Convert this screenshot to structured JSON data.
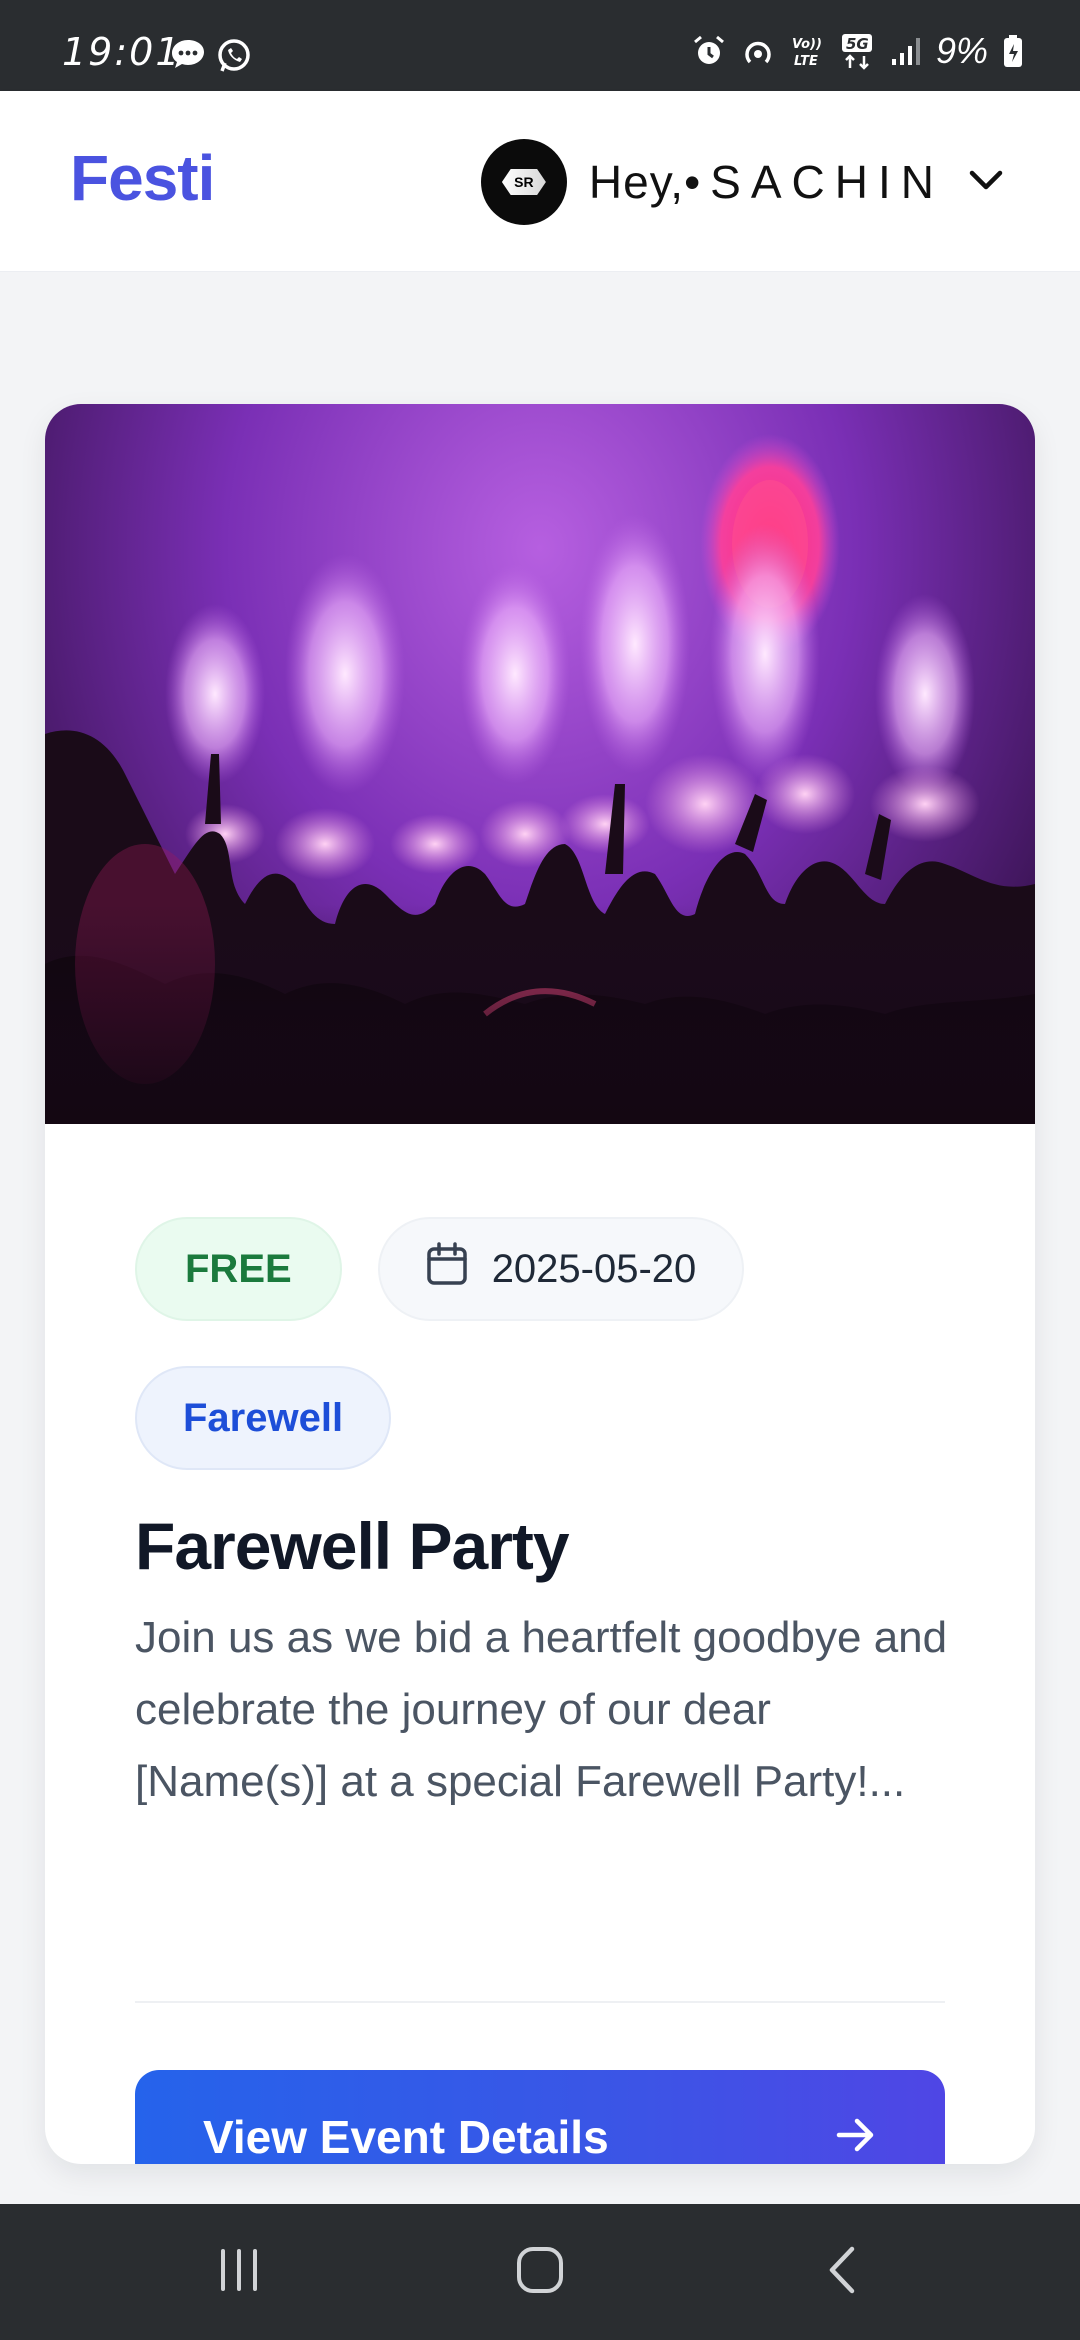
{
  "status_bar": {
    "time": "19:01",
    "battery": "9%",
    "left_icons": [
      "chat-bubble-icon",
      "whatsapp-icon"
    ],
    "right_icons": [
      "alarm-icon",
      "hotspot-icon",
      "volte-icon",
      "5g-icon",
      "signal-icon",
      "battery-icon"
    ],
    "network_label_1": "Vo))\nLTE",
    "network_label_2": "5G"
  },
  "header": {
    "brand": "Festi",
    "greeting": "Hey, ",
    "username": "•SACHIN",
    "avatar_initials": "SR",
    "dropdown_icon": "chevron-down-icon"
  },
  "event": {
    "price_badge": "FREE",
    "date": "2025-05-20",
    "category": "Farewell",
    "title": "Farewell Party",
    "description": "Join us as we bid a heartfelt goodbye and celebrate the journey of our dear [Name(s)] at a special Farewell Party!...",
    "cta_label": "View Event Details",
    "cta_icon": "arrow-right-icon",
    "date_icon": "calendar-icon"
  },
  "colors": {
    "brand": "#4a53e0",
    "cta_start": "#2563eb",
    "cta_end": "#4f46e5",
    "free_text": "#1b7a3d",
    "category_text": "#1d4ed8"
  },
  "nav_bar": {
    "buttons": [
      "recent-apps-icon",
      "home-icon",
      "back-icon"
    ]
  }
}
